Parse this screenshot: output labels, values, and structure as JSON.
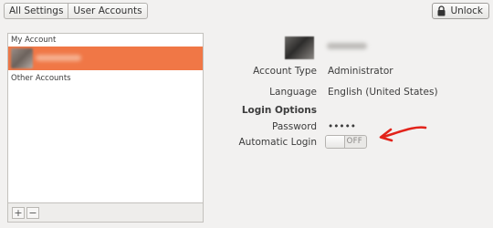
{
  "toolbar": {
    "breadcrumbs": [
      "All Settings",
      "User Accounts"
    ],
    "unlock_label": "Unlock",
    "unlock_icon": "lock-icon"
  },
  "account_list": {
    "my_account_header": "My Account",
    "other_accounts_header": "Other Accounts",
    "selected_row_color": "#f07746",
    "add_label": "+",
    "remove_label": "−"
  },
  "details": {
    "account_type_label": "Account Type",
    "account_type_value": "Administrator",
    "language_label": "Language",
    "language_value": "English (United States)",
    "login_options_title": "Login Options",
    "password_label": "Password",
    "password_value": "•••••",
    "auto_login_label": "Automatic Login",
    "auto_login_state": "OFF"
  },
  "annotation": {
    "arrow_color": "#e2231a"
  }
}
